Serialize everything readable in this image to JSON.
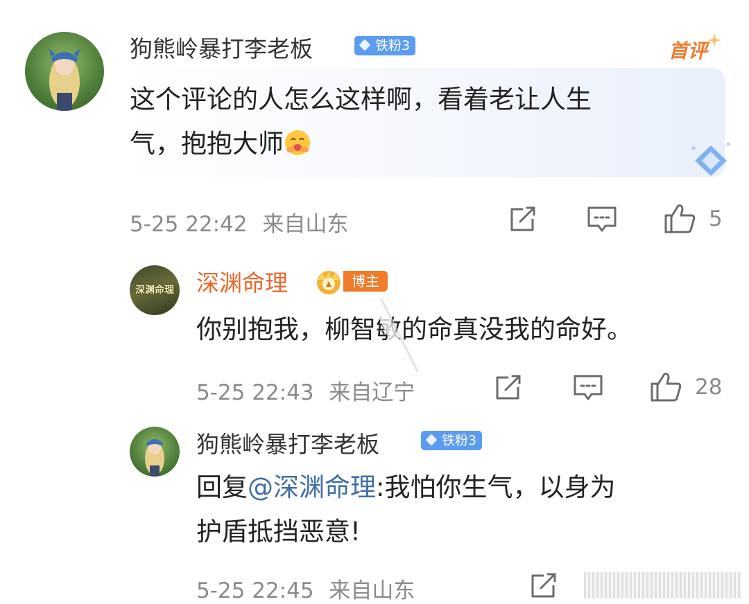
{
  "comments": [
    {
      "username": "狗熊岭暴打李老板",
      "fan_badge": "铁粉3",
      "first_tag": "首评",
      "text_line1": "这个评论的人怎么这样啊，看着老让人生",
      "text_line2": "气，抱抱大师",
      "emoji": "hug-emoji",
      "time": "5-25 22:42",
      "location": "来自山东",
      "likes": "5"
    },
    {
      "username": "深渊命理",
      "avatar_text": "深渊命理",
      "role_badge": "博主",
      "text_line1": "你别抱我，柳智敏的命真没我的命好。",
      "time": "5-25 22:43",
      "location": "来自辽宁",
      "likes": "28"
    },
    {
      "username": "狗熊岭暴打李老板",
      "fan_badge": "铁粉3",
      "reply_prefix": "回复",
      "mention": "@深渊命理",
      "text_line1_rest": ":我怕你生气，以身为",
      "text_line2": "护盾抵挡恶意!",
      "time": "5-25 22:45",
      "location": "来自山东"
    }
  ],
  "colors": {
    "accent_orange": "#ef7a2b",
    "badge_blue": "#5b9cf0",
    "mention_blue": "#3f6ea8",
    "meta_gray": "#8a8a8a"
  },
  "icons": [
    "share-icon",
    "comment-icon",
    "like-icon",
    "crown-icon",
    "diamond-icon"
  ]
}
